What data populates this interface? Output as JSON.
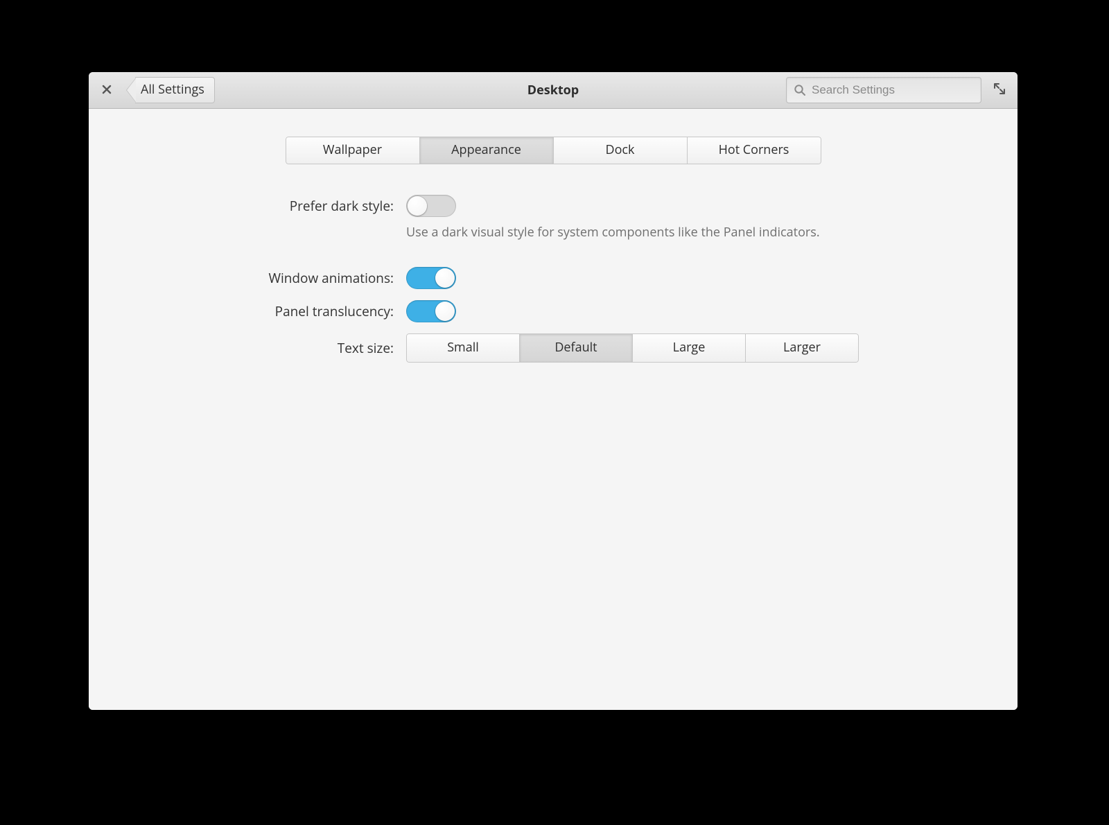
{
  "header": {
    "back_label": "All Settings",
    "title": "Desktop",
    "search_placeholder": "Search Settings"
  },
  "tabs": {
    "items": [
      "Wallpaper",
      "Appearance",
      "Dock",
      "Hot Corners"
    ],
    "active_index": 1
  },
  "settings": {
    "dark": {
      "label": "Prefer dark style:",
      "value": false,
      "description": "Use a dark visual style for system components like the Panel indicators."
    },
    "animations": {
      "label": "Window animations:",
      "value": true
    },
    "translucency": {
      "label": "Panel translucency:",
      "value": true
    },
    "text_size": {
      "label": "Text size:",
      "options": [
        "Small",
        "Default",
        "Large",
        "Larger"
      ],
      "active_index": 1
    }
  }
}
